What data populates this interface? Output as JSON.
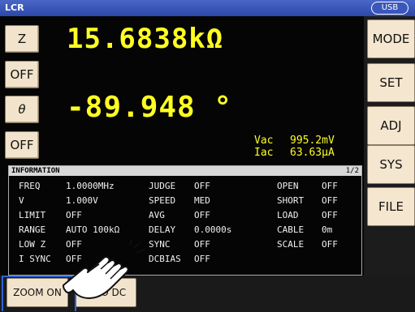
{
  "app": {
    "title": "LCR",
    "usb": "USB"
  },
  "left": {
    "param1": "Z",
    "range1": "OFF",
    "param2": "θ",
    "range2": "OFF"
  },
  "measure": {
    "value1": "15.6838kΩ",
    "value2": "-89.948 °",
    "vac_label": "Vac",
    "vac_value": "995.2mV",
    "iac_label": "Iac",
    "iac_value": "63.63μA"
  },
  "right_menu": [
    "MODE",
    "SET",
    "ADJ",
    "SYS",
    "FILE"
  ],
  "info": {
    "title": "INFORMATION",
    "page": "1/2",
    "col1": [
      [
        "FREQ",
        "1.0000MHz"
      ],
      [
        "V",
        "1.000V"
      ],
      [
        "LIMIT",
        "OFF"
      ],
      [
        "RANGE",
        "AUTO 100kΩ"
      ],
      [
        "LOW Z",
        "OFF"
      ],
      [
        "I SYNC",
        "OFF"
      ]
    ],
    "col2": [
      [
        "JUDGE",
        "OFF"
      ],
      [
        "SPEED",
        "MED"
      ],
      [
        "AVG",
        "OFF"
      ],
      [
        "DELAY",
        "0.0000s"
      ],
      [
        "SYNC",
        "OFF"
      ],
      [
        "DCBIAS",
        "OFF"
      ]
    ],
    "col3": [
      [
        "OPEN",
        "OFF"
      ],
      [
        "SHORT",
        "OFF"
      ],
      [
        "LOAD",
        "OFF"
      ],
      [
        "CABLE",
        "0m"
      ],
      [
        "SCALE",
        "OFF"
      ]
    ]
  },
  "bottom": {
    "zoom": "ZOOM ON",
    "info_dc": "INFO DC"
  },
  "colors": {
    "value": "#ffff22",
    "titlebar": "#2d48a8",
    "button": "#f2e4cc",
    "highlight": "#2f64d6"
  }
}
